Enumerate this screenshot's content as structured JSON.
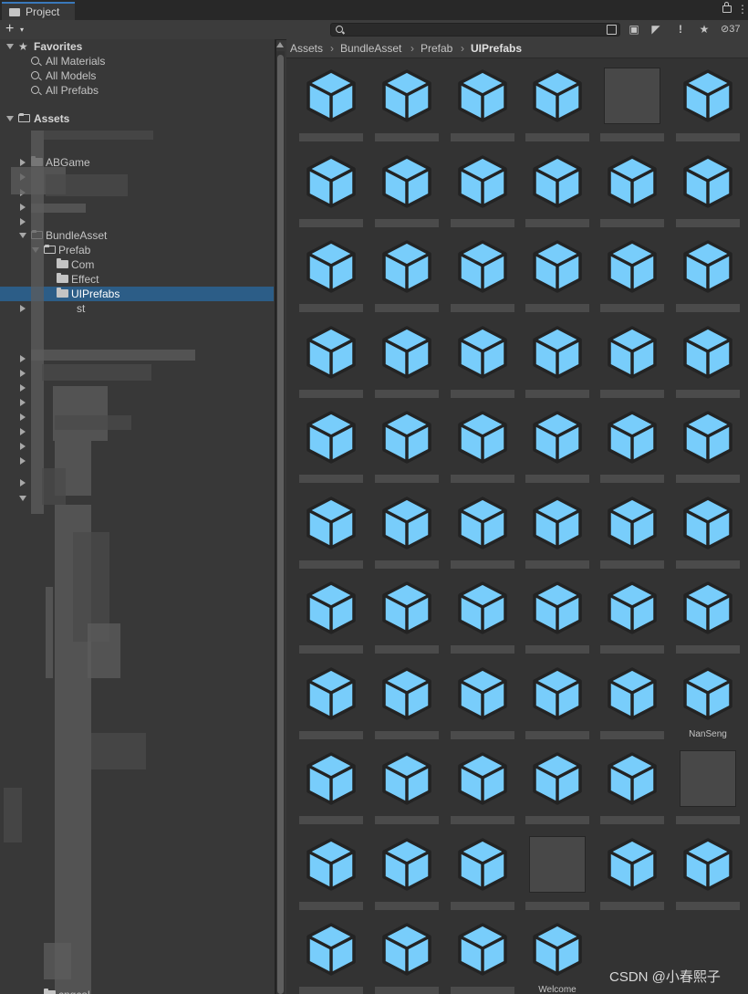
{
  "tab": {
    "label": "Project",
    "icon": "folder-icon"
  },
  "tab_controls": {
    "lock_icon": "lock-icon",
    "menu_icon": "kebab-menu-icon",
    "menu_glyph": "⋮"
  },
  "toolbar": {
    "add_label": "+",
    "add_caret": "▾",
    "search": {
      "value": "",
      "placeholder": ""
    },
    "buttons": [
      {
        "name": "search-by-type-icon",
        "glyph": "▣"
      },
      {
        "name": "filter-by-type-icon",
        "glyph": "◆"
      },
      {
        "name": "filter-by-label-icon",
        "glyph": "◤"
      },
      {
        "name": "log-icon",
        "glyph": "!"
      },
      {
        "name": "favorite-icon",
        "glyph": "★"
      }
    ],
    "hidden_packages_count": "37"
  },
  "sidebar": {
    "favorites": {
      "label": "Favorites",
      "items": [
        {
          "label": "All Materials"
        },
        {
          "label": "All Models"
        },
        {
          "label": "All Prefabs"
        }
      ]
    },
    "assets": {
      "label": "Assets",
      "folders": [
        {
          "label": "ABGame"
        },
        {
          "label": "BundleAsset"
        },
        {
          "label": "Prefab"
        },
        {
          "label": "Com"
        },
        {
          "label": "Effect"
        },
        {
          "label": "UIPrefabs",
          "selected": true
        }
      ],
      "partial_labels": [
        "st",
        "cngcal"
      ]
    }
  },
  "breadcrumb": [
    "Assets",
    "BundleAsset",
    "Prefab",
    "UIPrefabs"
  ],
  "grid": {
    "columns": 6,
    "total_items": 64,
    "sprite_item_indices": [
      4,
      53,
      57
    ],
    "item_icon": "prefab-cube-icon",
    "sprite_icon": "sprite-thumbnail",
    "visible_item_labels": {
      "47": "NanSeng",
      "63": "Welcome"
    }
  },
  "colors": {
    "prefab_cube": "#78cdfb",
    "cube_outline": "#232323",
    "selection": "#2c5d87",
    "tab_accent": "#3a79bb"
  },
  "watermark": "CSDN @小春熙子"
}
